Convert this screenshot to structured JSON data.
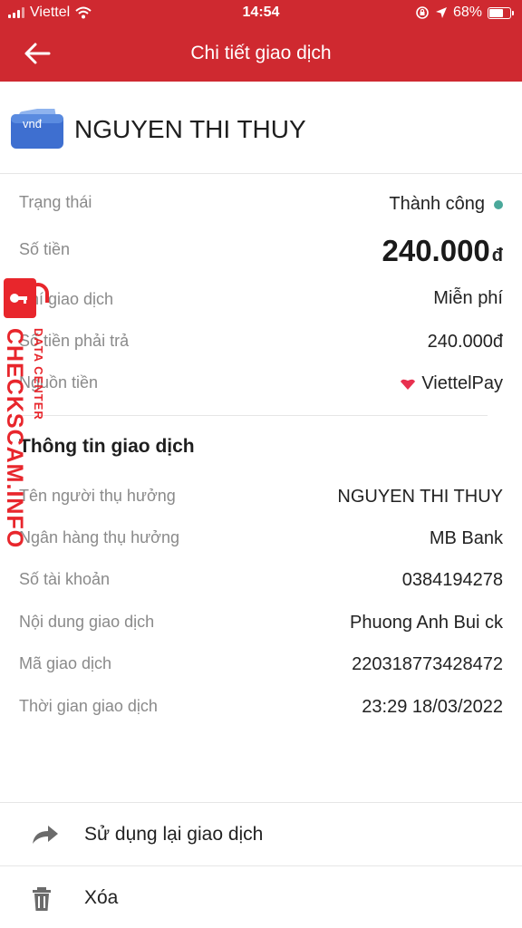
{
  "status_bar": {
    "carrier": "Viettel",
    "time": "14:54",
    "battery": "68%",
    "battery_level": 0.68
  },
  "header": {
    "title": "Chi tiết giao dịch"
  },
  "recipient": {
    "wallet_badge": "vnđ",
    "name": "NGUYEN THI THUY"
  },
  "summary": {
    "status_label": "Trạng thái",
    "status_value": "Thành công",
    "status_color": "#4aa89a",
    "amount_label": "Số tiền",
    "amount_value": "240.000",
    "amount_unit": "đ",
    "fee_label": "Phí giao dịch",
    "fee_value": "Miễn phí",
    "payable_label": "Số tiền phải trả",
    "payable_value": "240.000đ",
    "source_label": "Nguồn tiền",
    "source_value": "ViettelPay"
  },
  "details": {
    "title": "Thông tin giao dịch",
    "beneficiary_label": "Tên người thụ hưởng",
    "beneficiary_value": "NGUYEN THI THUY",
    "bank_label": "Ngân hàng thụ hưởng",
    "bank_value": "MB Bank",
    "account_label": "Số tài khoản",
    "account_value": "0384194278",
    "content_label": "Nội dung giao dịch",
    "content_value": "Phuong Anh Bui ck",
    "txid_label": "Mã giao dịch",
    "txid_value": "220318773428472",
    "time_label": "Thời gian giao dịch",
    "time_value": "23:29 18/03/2022"
  },
  "actions": {
    "reuse_label": "Sử dụng lại giao dịch",
    "delete_label": "Xóa"
  },
  "watermark": {
    "main": "CHECKSCAM.INFO",
    "sub": "DATA CENTER"
  },
  "colors": {
    "brand": "#cf2930",
    "watermark": "#e8262c",
    "wallet": "#3e6fd0"
  }
}
